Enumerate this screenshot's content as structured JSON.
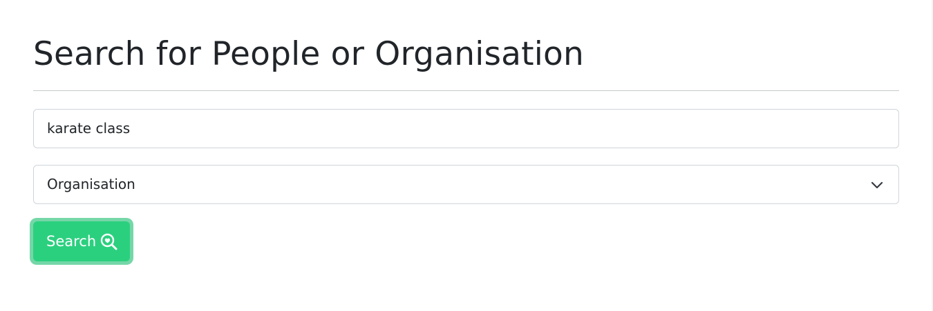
{
  "page": {
    "title": "Search for People or Organisation"
  },
  "search_form": {
    "query_value": "karate class",
    "type_select": {
      "selected": "Organisation"
    },
    "submit_label": "Search",
    "submit_icon": "search-heart-icon",
    "accent_color": "#2bd07f"
  }
}
